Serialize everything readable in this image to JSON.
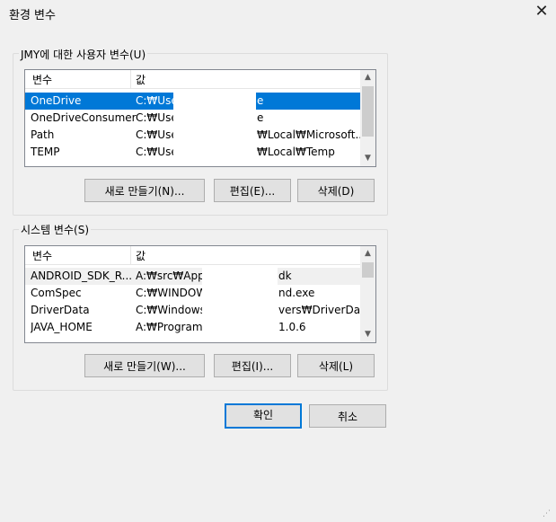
{
  "window": {
    "title": "환경 변수",
    "close_glyph": "✕"
  },
  "user_vars": {
    "group_label": "JMY에 대한 사용자 변수(U)",
    "col_name": "변수",
    "col_value": "값",
    "rows": [
      {
        "name": "OneDrive",
        "value_left": "C:₩User",
        "value_right": "e"
      },
      {
        "name": "OneDriveConsumer",
        "value_left": "C:₩User",
        "value_right": "e"
      },
      {
        "name": "Path",
        "value_left": "C:₩User",
        "value_right": "₩Local₩Microsoft..."
      },
      {
        "name": "TEMP",
        "value_left": "C:₩User",
        "value_right": "₩Local₩Temp"
      }
    ],
    "buttons": {
      "new": "새로 만들기(N)...",
      "edit": "편집(E)...",
      "delete": "삭제(D)"
    }
  },
  "system_vars": {
    "group_label": "시스템 변수(S)",
    "col_name": "변수",
    "col_value": "값",
    "rows": [
      {
        "name": "ANDROID_SDK_R...",
        "value_left": "A:₩src₩AppD",
        "value_right": "dk"
      },
      {
        "name": "ComSpec",
        "value_left": "C:₩WINDOW",
        "value_right": "nd.exe"
      },
      {
        "name": "DriverData",
        "value_left": "C:₩Windows₩",
        "value_right": "vers₩DriverData"
      },
      {
        "name": "JAVA_HOME",
        "value_left": "A:₩Program F",
        "value_right": "1.0.6"
      }
    ],
    "buttons": {
      "new": "새로 만들기(W)...",
      "edit": "편집(I)...",
      "delete": "삭제(L)"
    }
  },
  "dialog": {
    "ok": "확인",
    "cancel": "취소"
  },
  "scroll": {
    "up_glyph": "▲",
    "down_glyph": "▼"
  },
  "colors": {
    "selection": "#0078d7",
    "default_button_border": "#0078d7"
  }
}
